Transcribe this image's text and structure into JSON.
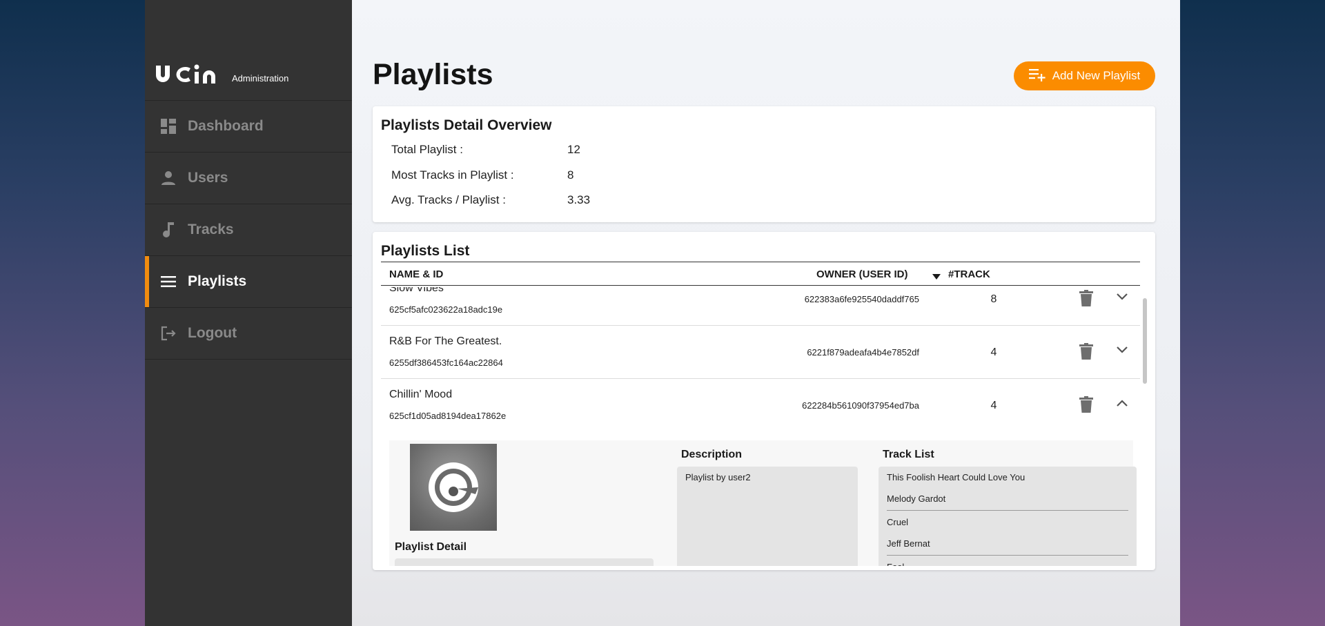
{
  "brand": {
    "logo_text": "ucin",
    "sub": "Administration"
  },
  "sidebar": {
    "items": [
      {
        "label": "Dashboard",
        "icon": "dashboard-icon",
        "active": false
      },
      {
        "label": "Users",
        "icon": "user-icon",
        "active": false
      },
      {
        "label": "Tracks",
        "icon": "music-note-icon",
        "active": false
      },
      {
        "label": "Playlists",
        "icon": "menu-icon",
        "active": true
      },
      {
        "label": "Logout",
        "icon": "logout-icon",
        "active": false
      }
    ]
  },
  "header": {
    "title": "Playlists",
    "add_button": "Add New Playlist"
  },
  "overview": {
    "title": "Playlists Detail Overview",
    "rows": [
      {
        "label": "Total Playlist :",
        "value": "12"
      },
      {
        "label": "Most Tracks in Playlist :",
        "value": "8"
      },
      {
        "label": "Avg. Tracks / Playlist :",
        "value": "3.33"
      }
    ]
  },
  "list": {
    "title": "Playlists List",
    "columns": {
      "name": "NAME & ID",
      "owner": "OWNER (USER ID)",
      "tracks": "#TRACK"
    },
    "rows": [
      {
        "name": "Slow Vibes",
        "id": "625cf5afc023622a18adc19e",
        "owner": "622383a6fe925540daddf765",
        "count": "8",
        "expanded": false
      },
      {
        "name": "R&B For The Greatest.",
        "id": "6255df386453fc164ac22864",
        "owner": "6221f879adeafa4b4e7852df",
        "count": "4",
        "expanded": false
      },
      {
        "name": "Chillin' Mood",
        "id": "625cf1d05ad8194dea17862e",
        "owner": "622284b561090f37954ed7ba",
        "count": "4",
        "expanded": true
      }
    ],
    "expanded": {
      "detail_title": "Playlist Detail",
      "description_title": "Description",
      "description": "Playlist by user2",
      "tracklist_title": "Track List",
      "tracks": [
        {
          "title": "This Foolish Heart Could Love You",
          "artist": "Melody Gardot"
        },
        {
          "title": "Cruel",
          "artist": "Jeff Bernat"
        },
        {
          "title": "Fool",
          "artist": ""
        }
      ]
    }
  },
  "colors": {
    "accent": "#fb8c00",
    "sidebar": "#333333",
    "active_bar": "#f28c0f"
  }
}
